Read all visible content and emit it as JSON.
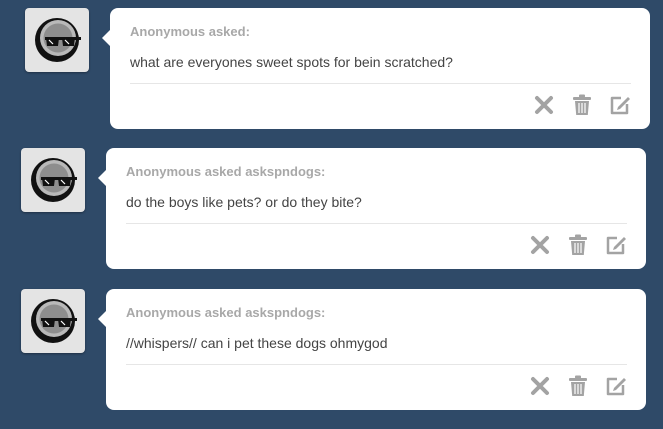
{
  "asks": [
    {
      "asker": "Anonymous asked:",
      "question": "what are everyones sweet spots for bein scratched?"
    },
    {
      "asker": "Anonymous asked askspndogs:",
      "question": "do the boys like pets? or do they bite?"
    },
    {
      "asker": "Anonymous asked askspndogs:",
      "question": "//whispers// can i pet these dogs ohmygod"
    }
  ],
  "icons": {
    "delete": "close-icon",
    "trash": "trash-icon",
    "edit": "edit-icon",
    "avatar": "anonymous-avatar-icon"
  },
  "colors": {
    "background": "#2f4a68",
    "card": "#ffffff",
    "asker_text": "#a8a8a8",
    "question_text": "#444444",
    "icon": "#a3a3a3"
  }
}
